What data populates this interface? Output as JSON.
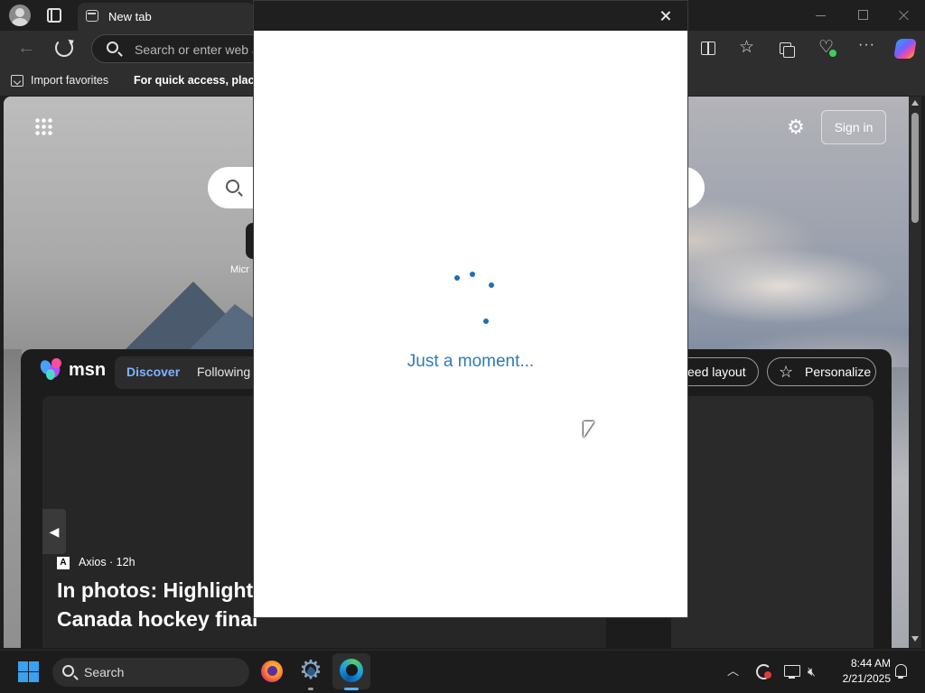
{
  "browser": {
    "tab_title": "New tab",
    "address_placeholder": "Search or enter web a",
    "favorites_bar": {
      "import_label": "Import favorites",
      "hint_text": "For quick access, place y"
    }
  },
  "newtab": {
    "signin_label": "Sign in",
    "quicklink_label": "Micr",
    "feed": {
      "brand": "msn",
      "tabs": [
        "Discover",
        "Following"
      ],
      "feed_layout_label": "eed layout",
      "personalize_label": "Personalize",
      "card": {
        "source": "Axios · 12h",
        "source_logo": "A",
        "headline_line1": "In photos: Highlights",
        "headline_line2": "Canada hockey final"
      }
    }
  },
  "dialog": {
    "message": "Just a moment..."
  },
  "taskbar": {
    "search_label": "Search",
    "time": "8:44 AM",
    "date": "2/21/2025"
  },
  "icons": {
    "apps": "apps-grid-icon",
    "settings": "gear-icon",
    "close": "close-icon",
    "spinner": "loading-spinner-icon"
  },
  "colors": {
    "accent": "#2b7bc0",
    "discover_tab": "#7fb4ff",
    "edge_accent": "#5ab0ff"
  }
}
